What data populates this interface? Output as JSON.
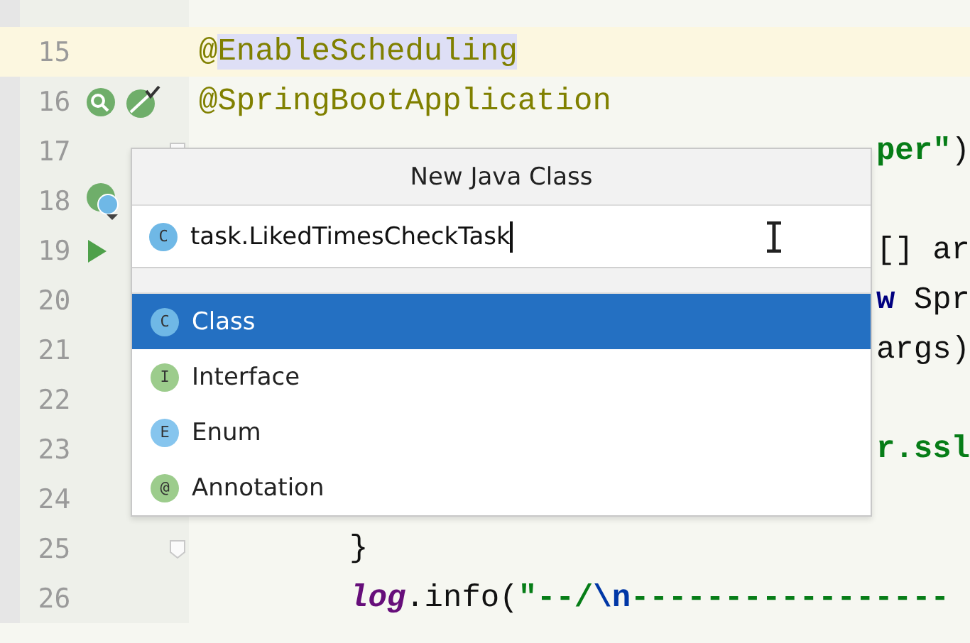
{
  "editor": {
    "lines": [
      {
        "number": "15",
        "kind": "top",
        "highlighted": true,
        "segments": [
          {
            "kind": "annotation",
            "text": "@"
          },
          {
            "kind": "annotation",
            "text": "EnableScheduling",
            "match": true
          }
        ]
      },
      {
        "number": "16",
        "kind": "top",
        "gutter": [
          {
            "kind": "bean-search"
          },
          {
            "kind": "bean-check"
          }
        ],
        "segments": [
          {
            "kind": "annotation",
            "text": "@SpringBootApplication"
          }
        ]
      },
      {
        "number": "17",
        "kind": "tail",
        "fold": true,
        "segments": [
          {
            "kind": "string",
            "text": "per\""
          },
          {
            "kind": "plain",
            "text": ")"
          }
        ]
      },
      {
        "number": "18",
        "kind": "top",
        "gutter": [
          {
            "kind": "bean-class"
          }
        ]
      },
      {
        "number": "19",
        "kind": "tail",
        "gutter": [
          {
            "kind": "run"
          }
        ],
        "segments": [
          {
            "kind": "plain",
            "text": "[] ar"
          }
        ]
      },
      {
        "number": "20",
        "kind": "tail",
        "segments": [
          {
            "kind": "keyword",
            "text": "w"
          },
          {
            "kind": "plain",
            "text": " Spr"
          }
        ]
      },
      {
        "number": "21",
        "kind": "tail",
        "segments": [
          {
            "kind": "plain",
            "text": "args)"
          }
        ]
      },
      {
        "number": "22",
        "kind": "top"
      },
      {
        "number": "23",
        "kind": "tail",
        "segments": [
          {
            "kind": "string",
            "text": "r.ssl"
          }
        ]
      },
      {
        "number": "24",
        "kind": "top"
      },
      {
        "number": "25",
        "kind": "nested",
        "fold": true,
        "segments": [
          {
            "kind": "plain",
            "text": "}"
          }
        ]
      },
      {
        "number": "26",
        "kind": "nested",
        "segments": [
          {
            "kind": "field",
            "text": "log"
          },
          {
            "kind": "plain",
            "text": ".info("
          },
          {
            "kind": "string",
            "text": "\"--/"
          },
          {
            "kind": "escape",
            "text": "\\n"
          },
          {
            "kind": "string",
            "text": "-----------------"
          }
        ]
      }
    ]
  },
  "dialog": {
    "title": "New Java Class",
    "input": {
      "icon": "C",
      "value": "task.LikedTimesCheckTask"
    },
    "items": [
      {
        "letter": "C",
        "label": "Class",
        "color": "#6fb8e6",
        "selected": true
      },
      {
        "letter": "I",
        "label": "Interface",
        "color": "#9ccc8c",
        "selected": false
      },
      {
        "letter": "E",
        "label": "Enum",
        "color": "#86c5ee",
        "selected": false
      },
      {
        "letter": "@",
        "label": "Annotation",
        "color": "#9ccc8c",
        "selected": false
      }
    ]
  }
}
